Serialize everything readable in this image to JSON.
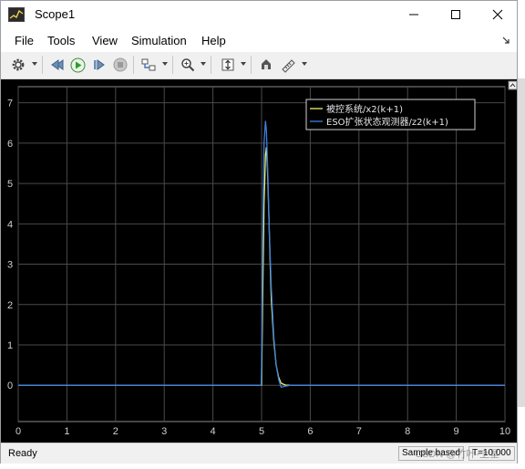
{
  "window": {
    "title": "Scope1",
    "controls": {
      "minimize": "minimize",
      "maximize": "maximize",
      "close": "close"
    }
  },
  "menu": {
    "items": [
      "File",
      "Tools",
      "View",
      "Simulation",
      "Help"
    ]
  },
  "toolbar": {
    "icons": [
      "gear-icon",
      "step-back-icon",
      "run-icon",
      "step-forward-icon",
      "stop-icon",
      "layout-icon",
      "zoom-icon",
      "autoscale-icon",
      "highlight-icon",
      "measure-icon"
    ]
  },
  "chart_data": {
    "type": "line",
    "background": "#000000",
    "grid": true,
    "xlim": [
      0,
      10
    ],
    "ylim": [
      -0.9,
      7.4
    ],
    "xticks": [
      "0",
      "1",
      "2",
      "3",
      "4",
      "5",
      "6",
      "7",
      "8",
      "9",
      "10"
    ],
    "yticks": [
      "0",
      "1",
      "2",
      "3",
      "4",
      "5",
      "6",
      "7"
    ],
    "legend_position": "top-right",
    "series": [
      {
        "name": "被控系统/x2(k+1)",
        "color": "#f2f26a",
        "x": [
          0,
          5.0,
          5.02,
          5.05,
          5.08,
          5.1,
          5.12,
          5.15,
          5.18,
          5.2,
          5.25,
          5.3,
          5.35,
          5.4,
          5.5,
          5.6,
          10
        ],
        "y": [
          0,
          0,
          2.0,
          4.5,
          5.7,
          5.9,
          5.4,
          4.2,
          2.9,
          2.1,
          1.1,
          0.5,
          0.2,
          0.05,
          0,
          0,
          0
        ]
      },
      {
        "name": "ESO扩张状态观测器/z2(k+1)",
        "color": "#3d7fe0",
        "x": [
          0,
          4.99,
          5.0,
          5.02,
          5.05,
          5.08,
          5.1,
          5.13,
          5.16,
          5.2,
          5.25,
          5.3,
          5.35,
          5.4,
          5.5,
          5.6,
          10
        ],
        "y": [
          0,
          0,
          0.5,
          3.5,
          6.0,
          6.55,
          6.3,
          5.2,
          3.8,
          2.4,
          1.2,
          0.5,
          0.15,
          -0.05,
          -0.02,
          0,
          0
        ]
      }
    ]
  },
  "status": {
    "ready": "Ready",
    "mode": "Sample based",
    "time": "T=10.000"
  },
  "watermark": "CSDN @竹叶-上星"
}
